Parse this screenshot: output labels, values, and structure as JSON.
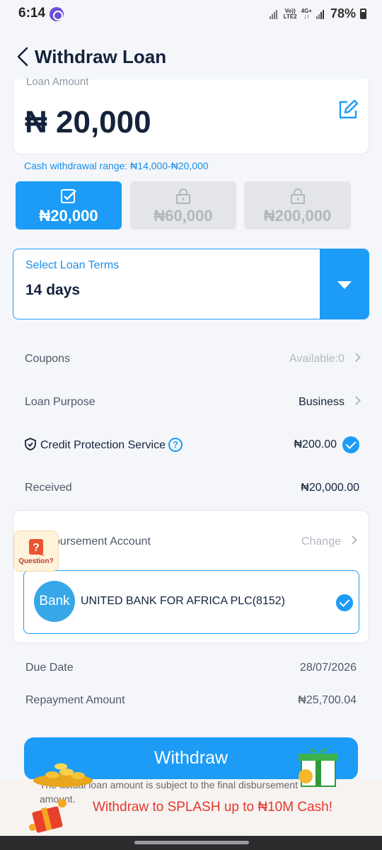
{
  "status_bar": {
    "time": "6:14",
    "network_top": "Vo))",
    "network_bottom": "LTE2",
    "network_4g": "4G+",
    "battery": "78%"
  },
  "header": {
    "title": "Withdraw Loan"
  },
  "loan_amount": {
    "label": "Loan Amount",
    "value": "₦ 20,000",
    "range_text": "Cash withdrawal range: ₦14,000-₦20,000"
  },
  "amount_options": [
    {
      "label": "₦20,000",
      "state": "selected"
    },
    {
      "label": "₦60,000",
      "state": "locked"
    },
    {
      "label": "₦200,000",
      "state": "locked"
    }
  ],
  "loan_terms": {
    "label": "Select Loan Terms",
    "value": "14 days"
  },
  "details": {
    "coupons_label": "Coupons",
    "coupons_value": "Available:0",
    "purpose_label": "Loan Purpose",
    "purpose_value": "Business",
    "protection_label": "Credit Protection Service",
    "protection_value": "₦200.00",
    "received_label": "Received",
    "received_value": "₦20,000.00"
  },
  "disbursement": {
    "title": "Disbursement Account",
    "change_label": "Change",
    "bank_logo_text": "Bank",
    "bank_name": "UNITED BANK FOR AFRICA PLC(8152)"
  },
  "question_badge": {
    "label": "Question?"
  },
  "summary": {
    "due_date_label": "Due Date",
    "due_date_value": "28/07/2026",
    "repayment_label": "Repayment Amount",
    "repayment_value": "₦25,700.04"
  },
  "withdraw_button": {
    "label": "Withdraw"
  },
  "promo": {
    "note": "The actual loan amount is subject to the final disbursement amount.",
    "text": "Withdraw to SPLASH up to ₦10M Cash!"
  },
  "colors": {
    "accent": "#1c9cf6",
    "promo_red": "#e5372b",
    "title": "#14233b"
  }
}
